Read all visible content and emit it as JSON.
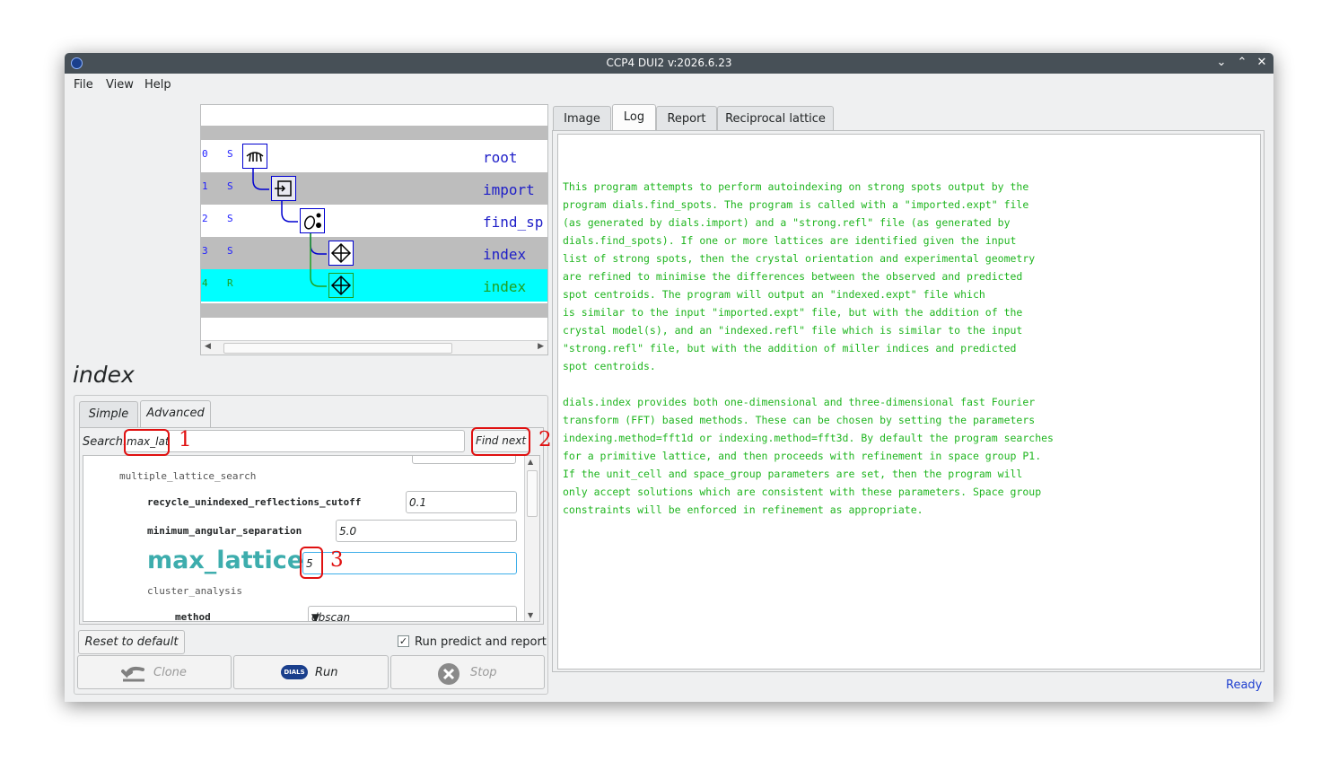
{
  "window": {
    "title": "CCP4 DUI2 v:2026.6.23"
  },
  "menu": [
    "File",
    "View",
    "Help"
  ],
  "tree": {
    "rows": [
      {
        "num": "0",
        "status": "S",
        "name": "root"
      },
      {
        "num": "1",
        "status": "S",
        "name": "import"
      },
      {
        "num": "2",
        "status": "S",
        "name": "find_sp"
      },
      {
        "num": "3",
        "status": "S",
        "name": "index"
      },
      {
        "num": "4",
        "status": "R",
        "name": "index"
      }
    ]
  },
  "step_title": "index",
  "param_tabs": [
    "Simple",
    "Advanced"
  ],
  "search": {
    "label": "Search:",
    "value": "max_lat",
    "find_label": "Find next"
  },
  "params": {
    "group1": "multiple_lattice_search",
    "recycle_label": "recycle_unindexed_reflections_cutoff",
    "recycle_value": "0.1",
    "min_ang_label": "minimum_angular_separation",
    "min_ang_value": "5.0",
    "max_lat_label": "max_lattices",
    "max_lat_value": "5",
    "group2": "cluster_analysis",
    "method_label": "method",
    "method_value": "dbscan"
  },
  "buttons": {
    "reset": "Reset to default",
    "run_predict": "Run predict and report",
    "clone": "Clone",
    "run": "Run",
    "stop": "Stop"
  },
  "right_tabs": [
    "Image",
    "Log",
    "Report",
    "Reciprocal lattice"
  ],
  "log": {
    "lines": [
      "This program attempts to perform autoindexing on strong spots output by the",
      "program dials.find_spots. The program is called with a \"imported.expt\" file",
      "(as generated by dials.import) and a \"strong.refl\" file (as generated by",
      "dials.find_spots). If one or more lattices are identified given the input",
      "list of strong spots, then the crystal orientation and experimental geometry",
      "are refined to minimise the differences between the observed and predicted",
      "spot centroids. The program will output an \"indexed.expt\" file which",
      "is similar to the input \"imported.expt\" file, but with the addition of the",
      "crystal model(s), and an \"indexed.refl\" file which is similar to the input",
      "\"strong.refl\" file, but with the addition of miller indices and predicted",
      "spot centroids.",
      "",
      "dials.index provides both one-dimensional and three-dimensional fast Fourier",
      "transform (FFT) based methods. These can be chosen by setting the parameters",
      "indexing.method=fft1d or indexing.method=fft3d. By default the program searches",
      "for a primitive lattice, and then proceeds with refinement in space group P1.",
      "If the unit_cell and space_group parameters are set, then the program will",
      "only accept solutions which are consistent with these parameters. Space group",
      "constraints will be enforced in refinement as appropriate."
    ]
  },
  "status": "Ready",
  "annotations": [
    "1",
    "2",
    "3"
  ]
}
